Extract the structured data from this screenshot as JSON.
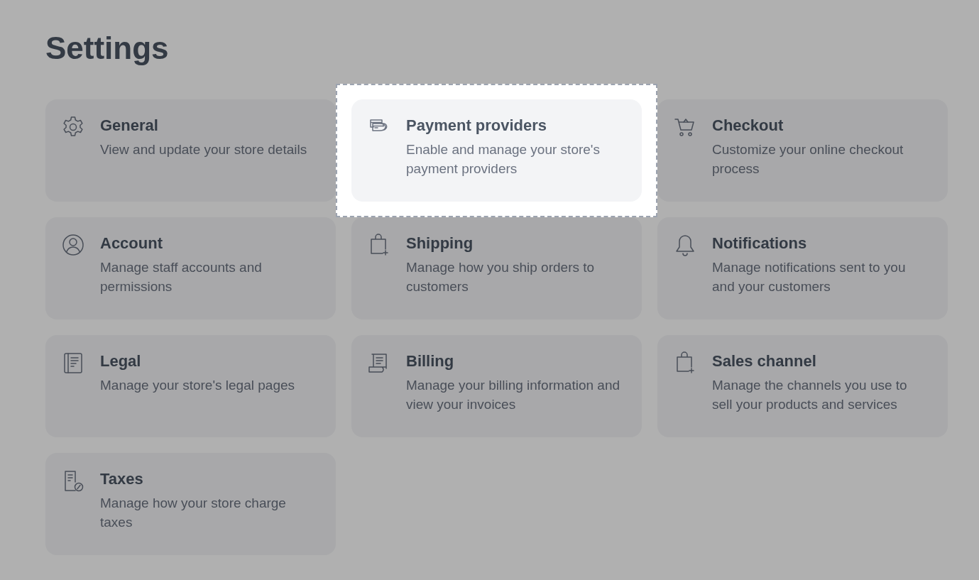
{
  "page": {
    "title": "Settings"
  },
  "cards": [
    {
      "kind": "gear",
      "title": "General",
      "description": "View and update your store details",
      "highlighted": false
    },
    {
      "kind": "cards",
      "title": "Payment providers",
      "description": "Enable and manage your store's payment providers",
      "highlighted": true
    },
    {
      "kind": "cart",
      "title": "Checkout",
      "description": "Customize your online checkout process",
      "highlighted": false
    },
    {
      "kind": "user",
      "title": "Account",
      "description": "Manage staff accounts and permissions",
      "highlighted": false
    },
    {
      "kind": "bag",
      "title": "Shipping",
      "description": "Manage how you ship orders to customers",
      "highlighted": false
    },
    {
      "kind": "bell",
      "title": "Notifications",
      "description": "Manage notifications sent to you and your customers",
      "highlighted": false
    },
    {
      "kind": "document",
      "title": "Legal",
      "description": "Manage your store's legal pages",
      "highlighted": false
    },
    {
      "kind": "receipt",
      "title": "Billing",
      "description": "Manage your billing information and view your invoices",
      "highlighted": false
    },
    {
      "kind": "bag",
      "title": "Sales channel",
      "description": "Manage the channels you use to sell your products and services",
      "highlighted": false
    },
    {
      "kind": "tax",
      "title": "Taxes",
      "description": "Manage how your store charge taxes",
      "highlighted": false
    }
  ]
}
